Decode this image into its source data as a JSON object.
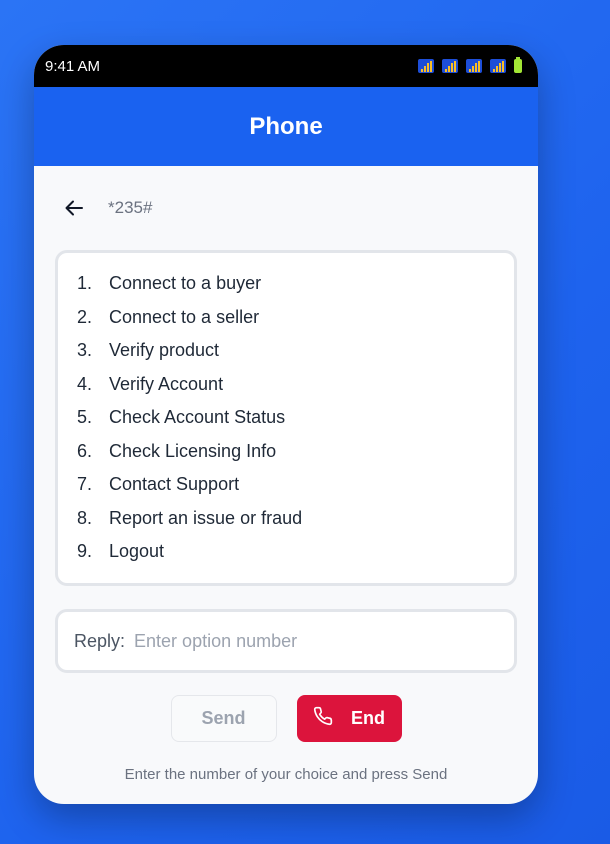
{
  "status_bar": {
    "time": "9:41 AM"
  },
  "header": {
    "title": "Phone"
  },
  "ussd": {
    "code": "*235#"
  },
  "menu": {
    "items": [
      {
        "num": "1.",
        "label": "Connect to a buyer"
      },
      {
        "num": "2.",
        "label": "Connect to a seller"
      },
      {
        "num": "3.",
        "label": "Verify product"
      },
      {
        "num": "4.",
        "label": "Verify Account"
      },
      {
        "num": "5.",
        "label": "Check Account Status"
      },
      {
        "num": "6.",
        "label": "Check Licensing Info"
      },
      {
        "num": "7.",
        "label": "Contact Support"
      },
      {
        "num": "8.",
        "label": "Report an issue or fraud"
      },
      {
        "num": "9.",
        "label": "Logout"
      }
    ]
  },
  "reply": {
    "label": "Reply:",
    "placeholder": "Enter option number",
    "value": ""
  },
  "buttons": {
    "send_label": "Send",
    "end_label": "End"
  },
  "hint": "Enter the number of your choice and press Send",
  "colors": {
    "accent": "#1a62f0",
    "end": "#dc143c",
    "background": "#2b74f5"
  },
  "icons": {
    "back": "arrow-left-icon",
    "call": "phone-icon",
    "signal": "signal-icon",
    "battery": "battery-icon"
  }
}
